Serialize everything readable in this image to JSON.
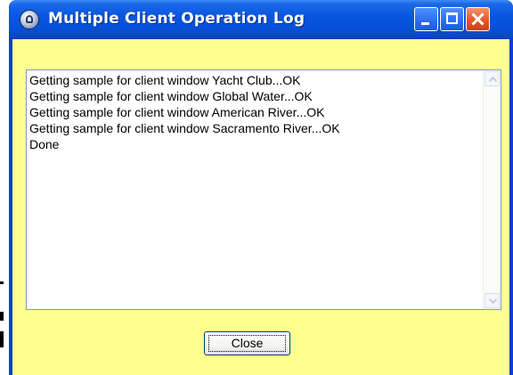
{
  "window": {
    "title": "Multiple Client Operation Log",
    "icon": "app-globe-icon",
    "controls": [
      "minimize-icon",
      "maximize-icon",
      "close-icon"
    ]
  },
  "log": {
    "lines": [
      "Getting sample for client window Yacht Club...OK",
      "Getting sample for client window Global Water...OK",
      "Getting sample for client window American River...OK",
      "Getting sample for client window Sacramento River...OK",
      "Done"
    ]
  },
  "buttons": {
    "close_label": "Close"
  },
  "colors": {
    "titlebar": "#0a56df",
    "client_background": "#ffff90",
    "close_control": "#e4572a"
  }
}
